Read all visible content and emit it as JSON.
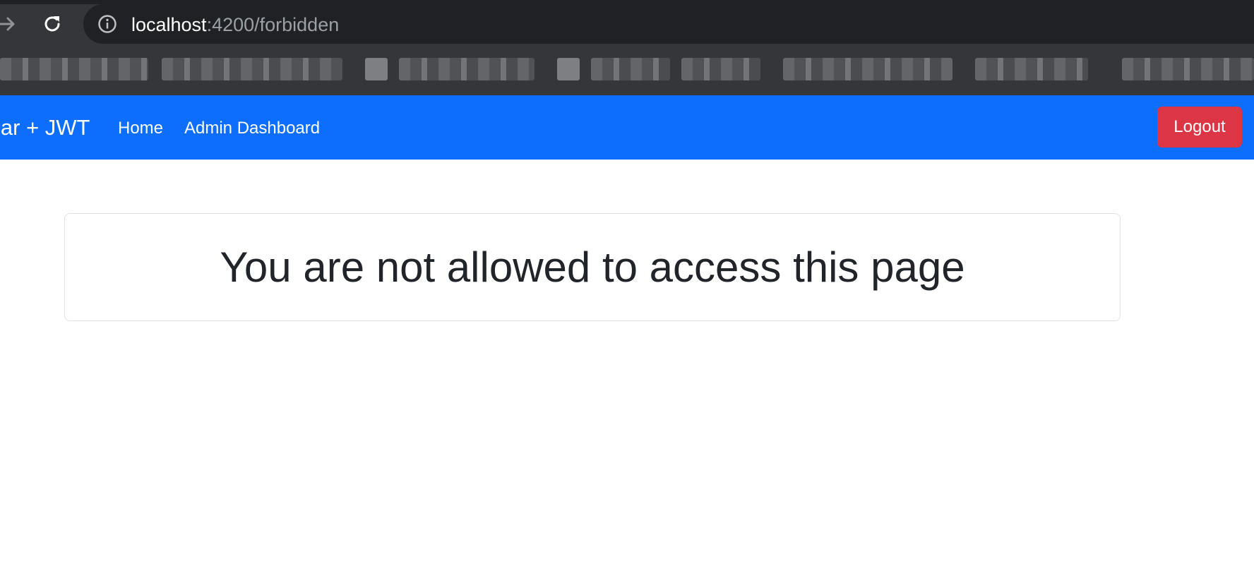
{
  "browser": {
    "url_host": "localhost",
    "url_path": ":4200/forbidden",
    "icons": {
      "forward": "arrow-forward-icon",
      "reload": "reload-icon",
      "site_info": "info-icon"
    }
  },
  "navbar": {
    "brand": "lar + JWT",
    "links": [
      "Home",
      "Admin Dashboard"
    ],
    "logout_label": "Logout",
    "colors": {
      "background": "#0d6efd",
      "logout": "#dc3545"
    }
  },
  "main": {
    "heading": "You are not allowed to access this page"
  }
}
